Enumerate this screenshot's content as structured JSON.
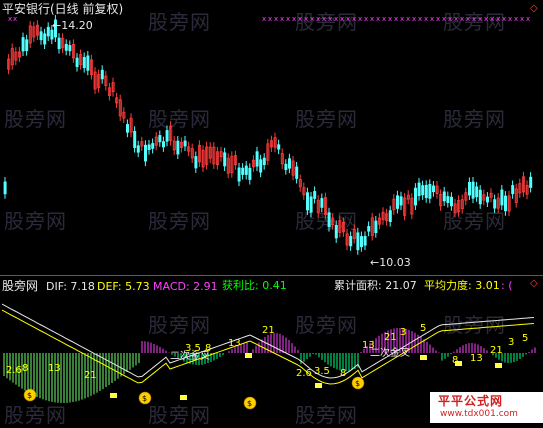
{
  "upper_panel": {
    "stock_title": "平安银行(日线 前复权)",
    "high_label": "14.20",
    "low_label": "10.03",
    "title_color": "#e8e8e8",
    "up_color": "#ff3c3c",
    "down_color": "#54ffff",
    "marker_color": "#ff40ff"
  },
  "indicator_header": {
    "name": "股旁网",
    "dif_label": "DIF: 7.18",
    "def_label": "DEF: 5.73",
    "macd_label": "MACD: 2.91",
    "profit_label": "获利比: 0.41",
    "area_label": "累计面积: 21.07",
    "strength_label": "平均力度: 3.01",
    "tail_label": ": (",
    "colors": {
      "name": "#e8e8e8",
      "dif": "#e8e8e8",
      "def": "#ffff00",
      "macd": "#ff40ff",
      "profit": "#00ff00",
      "area": "#e8e8e8",
      "strength": "#ffff00",
      "tail": "#ff40ff"
    }
  },
  "lower_panel": {
    "annotations": [
      "2.6",
      "8",
      "13",
      "21",
      "3.5",
      "8",
      "13",
      "21",
      "2.6",
      "3.5",
      "8",
      "13",
      "21",
      "3",
      "5",
      "8",
      "13",
      "21",
      "3",
      "5"
    ],
    "cross_labels": [
      "二次金叉",
      "二次金叉"
    ],
    "money_bag_icon": "money-bag-icon"
  },
  "watermark": "股旁网",
  "footer_logo": "平平公式网",
  "footer_url": "www.tdx001.com"
}
